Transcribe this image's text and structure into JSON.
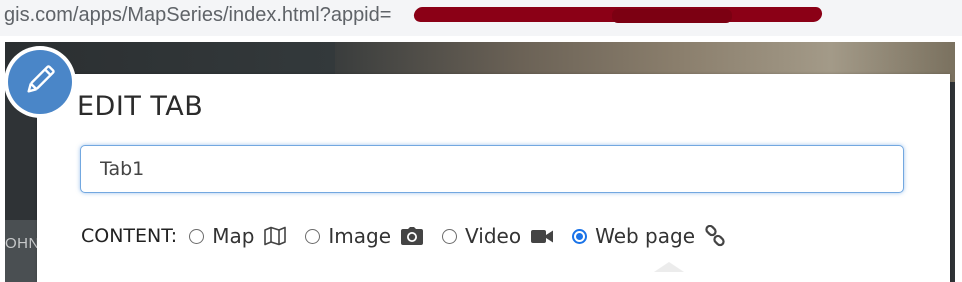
{
  "browser": {
    "url": "gis.com/apps/MapSeries/index.html?appid="
  },
  "background": {
    "side_label": "OHN"
  },
  "dialog": {
    "title": "EDIT TAB",
    "tab_name_value": "Tab1",
    "content_label": "CONTENT:",
    "options": [
      {
        "label": "Map",
        "icon": "map-icon",
        "selected": false
      },
      {
        "label": "Image",
        "icon": "camera-icon",
        "selected": false
      },
      {
        "label": "Video",
        "icon": "video-camera-icon",
        "selected": false
      },
      {
        "label": "Web page",
        "icon": "link-icon",
        "selected": true
      }
    ]
  },
  "colors": {
    "accent": "#1a73e8",
    "badge": "#4a86c8",
    "redaction": "#8b0016"
  }
}
